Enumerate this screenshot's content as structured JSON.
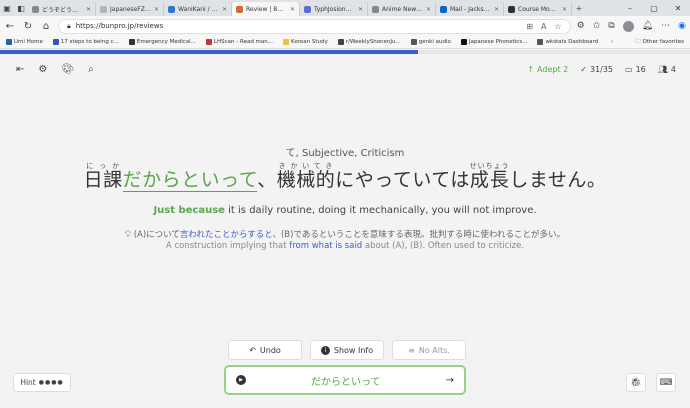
{
  "browser": {
    "tabs": [
      {
        "title": "どうぞどうも – にほ",
        "color": "#888"
      },
      {
        "title": "JapaneseFZ! 5",
        "color": "#b0b4bb"
      },
      {
        "title": "WaniKani / Revi",
        "color": "#2e77d0"
      },
      {
        "title": "Review | Bunpr",
        "color": "#d36b2c",
        "active": true
      },
      {
        "title": "TyphJosion101",
        "color": "#5b6fd6"
      },
      {
        "title": "Anime News Ni",
        "color": "#888"
      },
      {
        "title": "Mail - Jackson",
        "color": "#0a64c2"
      },
      {
        "title": "Course Module",
        "color": "#333"
      }
    ],
    "url": "https://bunpro.jp/reviews",
    "bookmarks": [
      {
        "label": "Umi Home",
        "color": "#2266aa"
      },
      {
        "label": "17 steps to being c...",
        "color": "#3355bb"
      },
      {
        "label": "Emergency Medical...",
        "color": "#333"
      },
      {
        "label": "LHScan - Read man...",
        "color": "#cc3333"
      },
      {
        "label": "Korean Study",
        "color": "#f2c230"
      },
      {
        "label": "r/WeeklyShonenJu...",
        "color": "#444"
      },
      {
        "label": "genki audio",
        "color": "#555"
      },
      {
        "label": "Japanese Phonetics...",
        "color": "#111"
      },
      {
        "label": "wkstats Dashboard",
        "color": "#555"
      }
    ],
    "other_favorites": "Other favorites"
  },
  "progress_fraction": 0.606,
  "stats": {
    "level": "Adept 2",
    "reviewed": "31/35",
    "cards": "16",
    "people": "4"
  },
  "particle_meaning": "て, Subjective, Criticism",
  "sentence": {
    "parts": [
      {
        "type": "ruby",
        "base": "日課",
        "rt": "にっか"
      },
      {
        "type": "target",
        "text": "だからといって"
      },
      {
        "type": "text",
        "text": "、"
      },
      {
        "type": "ruby",
        "base": "機械的",
        "rt": "きかいてき"
      },
      {
        "type": "text",
        "text": "にやっていては"
      },
      {
        "type": "ruby",
        "base": "成長",
        "rt": "せいちょう"
      },
      {
        "type": "text",
        "text": "しません。"
      }
    ]
  },
  "translation": {
    "highlight": "Just because",
    "rest": " it is daily routine, doing it mechanically, you will not improve."
  },
  "explanation_jp": {
    "prefix": "(A)について",
    "blue": "言われたことからすると",
    "suffix": "、(B)であるということを意味する表現。批判する時に使われることが多い。"
  },
  "explanation_en": {
    "prefix": "A construction implying that ",
    "blue": "from what is said",
    "suffix": " about (A), (B). Often used to criticize."
  },
  "buttons": {
    "undo": "Undo",
    "show_info": "Show Info",
    "no_alts": "No Alts."
  },
  "hint": {
    "label": "Hint",
    "dots": "●●●●"
  },
  "answer": {
    "value": "だからといって"
  }
}
